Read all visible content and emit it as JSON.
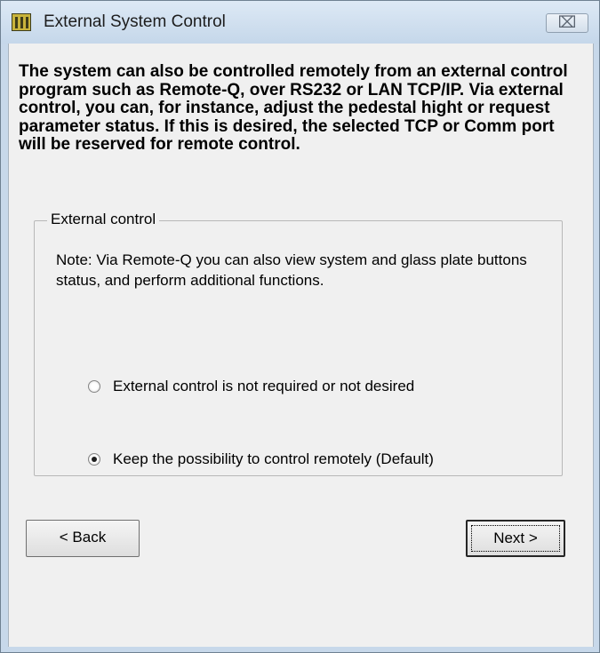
{
  "window": {
    "title": "External System Control",
    "close_symbol": "⌧",
    "icon": "app-icon"
  },
  "intro_text": "The system can also be controlled remotely from an external control program such as Remote-Q, over RS232 or LAN TCP/IP. Via external control, you can, for instance, adjust the pedestal hight or request parameter status. If this is desired, the selected TCP or Comm port will be reserved for remote control.",
  "group": {
    "label": "External control",
    "note": "Note: Via Remote-Q you can also view system and glass plate buttons status, and perform additional functions.",
    "options": [
      {
        "label": "External control is not required or not desired",
        "selected": false
      },
      {
        "label": "Keep the possibility to control remotely  (Default)",
        "selected": true
      }
    ]
  },
  "buttons": {
    "back_label": "< Back",
    "next_label": "Next >"
  }
}
